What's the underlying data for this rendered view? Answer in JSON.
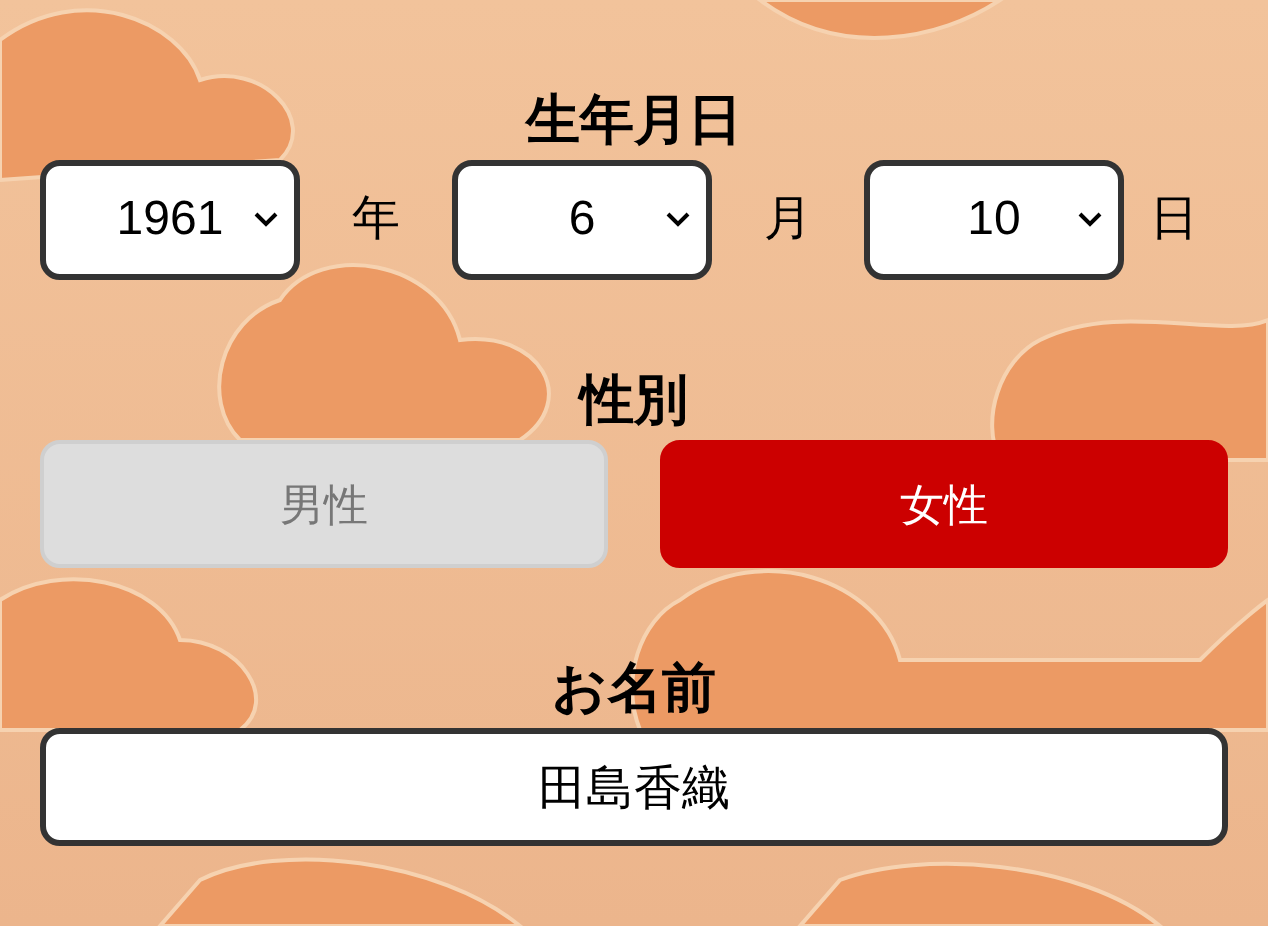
{
  "birth_date": {
    "label": "生年月日",
    "fields": [
      {
        "value": "1961",
        "unit": "年"
      },
      {
        "value": "6",
        "unit": "月"
      },
      {
        "value": "10",
        "unit": "日"
      }
    ]
  },
  "gender": {
    "label": "性別",
    "options": [
      {
        "label": "男性",
        "selected": false
      },
      {
        "label": "女性",
        "selected": true
      }
    ]
  },
  "name": {
    "label": "お名前",
    "value": "田島香織"
  }
}
